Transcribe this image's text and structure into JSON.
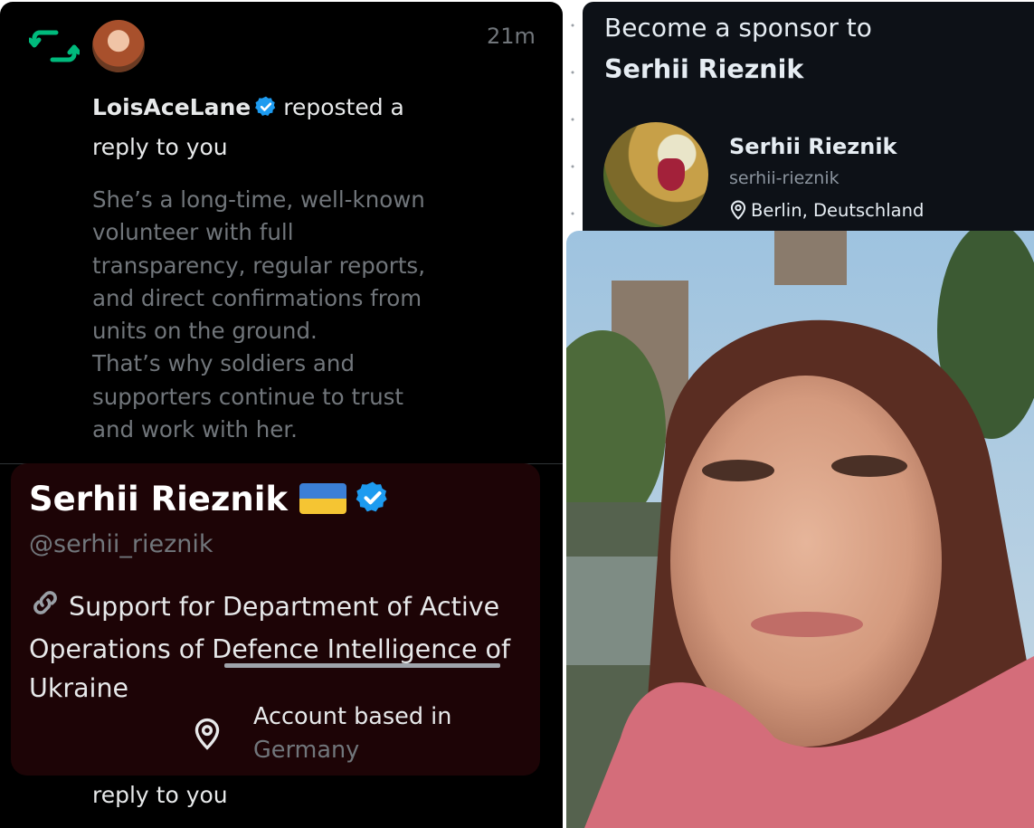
{
  "notification": {
    "time": "21m",
    "user_name": "LoisAceLane",
    "action_text": "reposted a",
    "action_text_2": "reply to you",
    "reply_lines": [
      "She’s a long-time, well-known",
      "volunteer with full",
      "transparency, regular reports,",
      "and direct confirmations from",
      "units on the ground.",
      "That’s why soldiers and",
      "supporters continue to trust",
      "and work with her."
    ],
    "bottom_text": "reply to you",
    "colors": {
      "background": "#000000",
      "repost_green": "#00ba7c",
      "verified_blue": "#1d9bf0"
    }
  },
  "profile_card": {
    "name": "Serhii Rieznik",
    "handle": "@serhii_rieznik",
    "bio_lines": [
      "Support for Department of Active",
      "Operations of",
      "Defence Intelligence",
      "of",
      "Ukraine"
    ],
    "based_label": "Account based in",
    "based_country": "Germany",
    "icons": [
      "ukraine-flag-icon",
      "verified-badge-icon",
      "link-icon",
      "location-pin-icon"
    ],
    "colors": {
      "background": "#1d0406"
    }
  },
  "sponsor": {
    "title_line1": "Become a sponsor to",
    "title_line2": "Serhii Rieznik",
    "name": "Serhii Rieznik",
    "username": "serhii-rieznik",
    "location": "Berlin, Deutschland",
    "colors": {
      "background": "#0d1117"
    }
  }
}
